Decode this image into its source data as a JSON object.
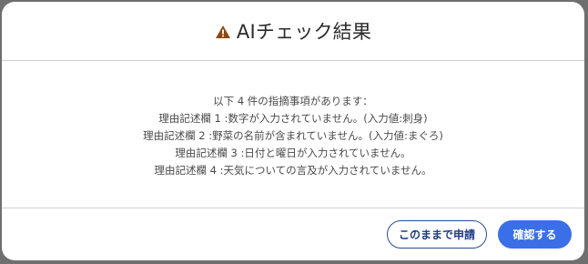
{
  "dialog": {
    "title": "AIチェック結果",
    "icon": "warning-icon",
    "icon_color": "#8a4b12"
  },
  "message": {
    "lines": [
      "以下 4 件の指摘事項があります：",
      "理由記述欄 1 :数字が入力されていません。(入力値:刺身)",
      "理由記述欄 2 :野菜の名前が含まれていません。(入力値:まぐろ)",
      "理由記述欄 3 :日付と曜日が入力されていません。",
      "理由記述欄 4 :天気についての言及が入力されていません。"
    ]
  },
  "buttons": {
    "submit_anyway": "このままで申請",
    "confirm": "確認する"
  },
  "colors": {
    "primary": "#3b6fe8",
    "secondary_text": "#1e3a8a"
  }
}
